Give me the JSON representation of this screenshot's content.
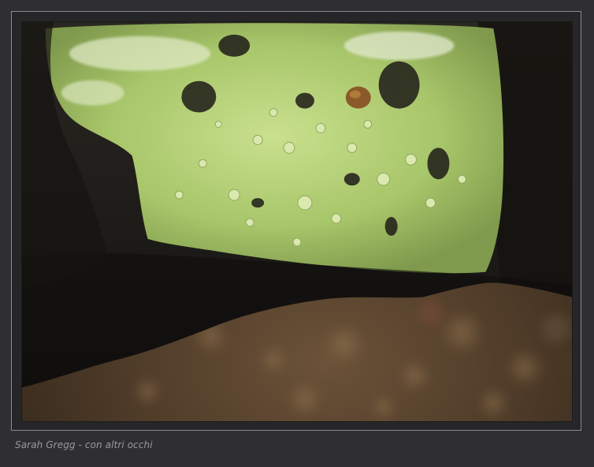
{
  "caption": {
    "credit": "Sarah Gregg - con altri occhi"
  },
  "colors": {
    "page_background": "#2f2f31",
    "frame_border": "#8a8a8c",
    "lichen_green": "#b5d27a",
    "bark_dark": "#1c1a17",
    "bokeh_brown": "#5a4330"
  }
}
